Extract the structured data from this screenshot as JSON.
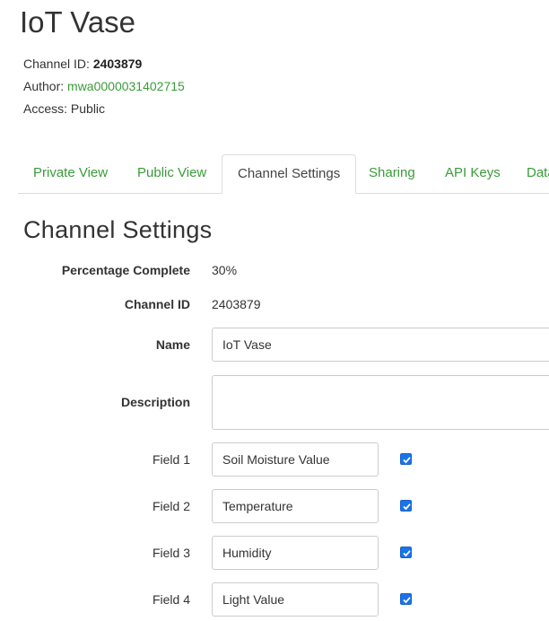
{
  "channel": {
    "title": "IoT Vase",
    "id_label": "Channel ID:",
    "id_value": "2403879",
    "author_label": "Author:",
    "author_value": "mwa0000031402715",
    "access_label": "Access:",
    "access_value": "Public"
  },
  "tabs": [
    {
      "label": "Private View",
      "active": false
    },
    {
      "label": "Public View",
      "active": false
    },
    {
      "label": "Channel Settings",
      "active": true
    },
    {
      "label": "Sharing",
      "active": false
    },
    {
      "label": "API Keys",
      "active": false
    },
    {
      "label": "Data Import / Export",
      "active": false
    }
  ],
  "settings": {
    "heading": "Channel Settings",
    "percentage_label": "Percentage Complete",
    "percentage_value": "30%",
    "channel_id_label": "Channel ID",
    "channel_id_value": "2403879",
    "name_label": "Name",
    "name_value": "IoT Vase",
    "description_label": "Description",
    "description_value": "",
    "fields": [
      {
        "label": "Field 1",
        "value": "Soil Moisture Value",
        "checked": true
      },
      {
        "label": "Field 2",
        "value": "Temperature",
        "checked": true
      },
      {
        "label": "Field 3",
        "value": "Humidity",
        "checked": true
      },
      {
        "label": "Field 4",
        "value": "Light Value",
        "checked": true
      }
    ]
  },
  "colors": {
    "link": "#3a9b3a",
    "checkbox": "#1a73e8",
    "text": "#333333",
    "border": "#cccccc"
  }
}
